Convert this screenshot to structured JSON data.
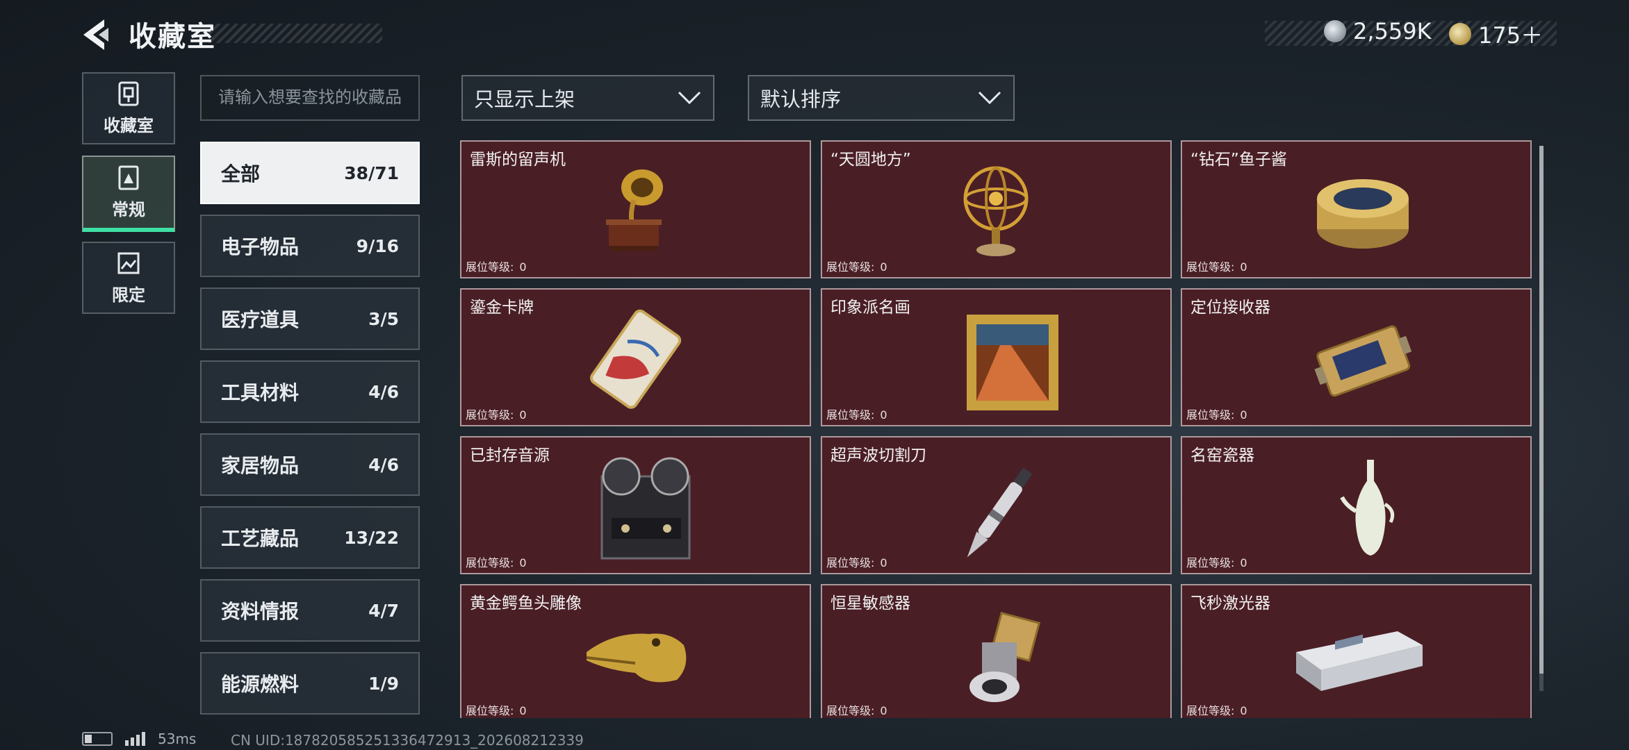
{
  "header": {
    "title": "收藏室",
    "currency1": {
      "icon": "silver-coin-icon",
      "value": "2,559K"
    },
    "currency2": {
      "icon": "gold-coin-icon",
      "value": "175＋"
    }
  },
  "side_tabs": [
    {
      "label": "收藏室",
      "icon": "vault-icon"
    },
    {
      "label": "常规",
      "icon": "box-icon",
      "active": true
    },
    {
      "label": "限定",
      "icon": "image-icon"
    }
  ],
  "search": {
    "placeholder": "请输入想要查找的收藏品"
  },
  "filters": {
    "shelf": "只显示上架",
    "sort": "默认排序"
  },
  "categories": [
    {
      "name": "全部",
      "count": "38/71",
      "active": true
    },
    {
      "name": "电子物品",
      "count": "9/16"
    },
    {
      "name": "医疗道具",
      "count": "3/5"
    },
    {
      "name": "工具材料",
      "count": "4/6"
    },
    {
      "name": "家居物品",
      "count": "4/6"
    },
    {
      "name": "工艺藏品",
      "count": "13/22"
    },
    {
      "name": "资料情报",
      "count": "4/7"
    },
    {
      "name": "能源燃料",
      "count": "1/9"
    }
  ],
  "level_label": "展位等级:",
  "items": [
    {
      "name": "雷斯的留声机",
      "level": "0",
      "icon": "gramophone-icon"
    },
    {
      "name": "“天圆地方”",
      "level": "0",
      "icon": "armillary-sphere-icon"
    },
    {
      "name": "“钻石”鱼子酱",
      "level": "0",
      "icon": "caviar-tin-icon"
    },
    {
      "name": "鎏金卡牌",
      "level": "0",
      "icon": "gilded-card-icon"
    },
    {
      "name": "印象派名画",
      "level": "0",
      "icon": "framed-painting-icon"
    },
    {
      "name": "定位接收器",
      "level": "0",
      "icon": "gps-receiver-icon"
    },
    {
      "name": "已封存音源",
      "level": "0",
      "icon": "reel-recorder-icon"
    },
    {
      "name": "超声波切割刀",
      "level": "0",
      "icon": "ultrasonic-cutter-icon"
    },
    {
      "name": "名窑瓷器",
      "level": "0",
      "icon": "porcelain-vase-icon"
    },
    {
      "name": "黄金鳄鱼头雕像",
      "level": "0",
      "icon": "gold-crocodile-head-icon"
    },
    {
      "name": "恒星敏感器",
      "level": "0",
      "icon": "star-sensor-icon"
    },
    {
      "name": "飞秒激光器",
      "level": "0",
      "icon": "femtosecond-laser-icon"
    }
  ],
  "status": {
    "latency": "53ms",
    "uid": "CN UID:18782058525133647291​3_202608212339"
  }
}
